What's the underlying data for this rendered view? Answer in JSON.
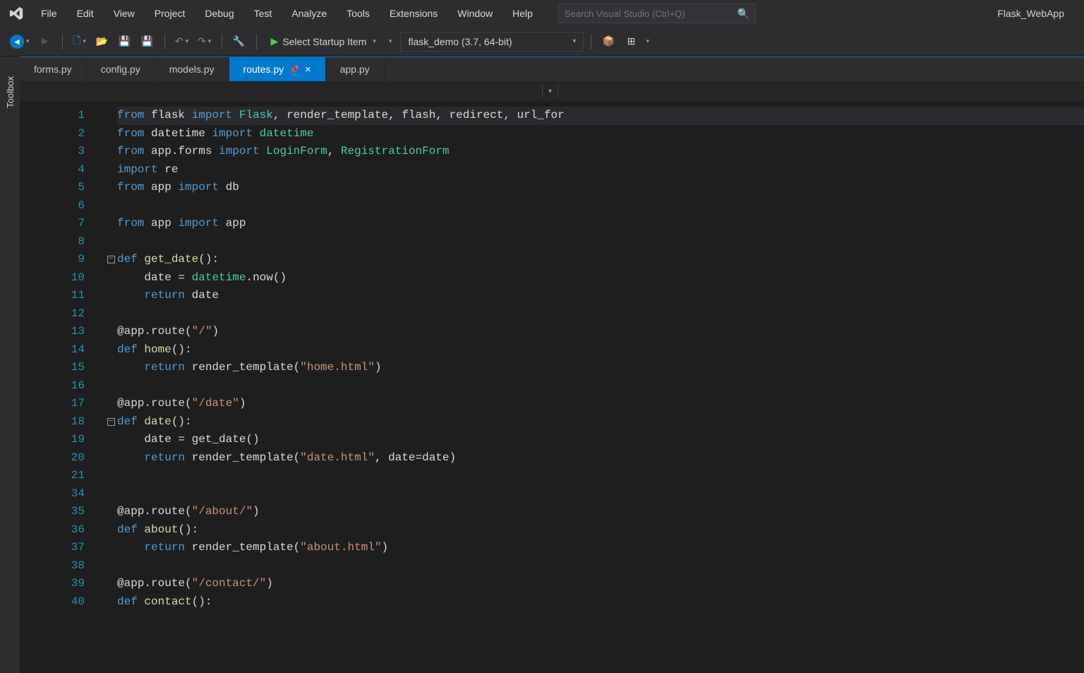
{
  "menu": {
    "items": [
      "File",
      "Edit",
      "View",
      "Project",
      "Debug",
      "Test",
      "Analyze",
      "Tools",
      "Extensions",
      "Window",
      "Help"
    ]
  },
  "search": {
    "placeholder": "Search Visual Studio (Ctrl+Q)"
  },
  "project_label": "Flask_WebApp",
  "toolbar": {
    "startup": "Select Startup Item",
    "env": "flask_demo (3.7, 64-bit)"
  },
  "side_tab": "Toolbox",
  "tabs": [
    {
      "label": "forms.py",
      "active": false
    },
    {
      "label": "config.py",
      "active": false
    },
    {
      "label": "models.py",
      "active": false
    },
    {
      "label": "routes.py",
      "active": true,
      "pinned": true,
      "closable": true
    },
    {
      "label": "app.py",
      "active": false
    }
  ],
  "code": {
    "line_numbers": [
      1,
      2,
      3,
      4,
      5,
      6,
      7,
      8,
      9,
      10,
      11,
      12,
      13,
      14,
      15,
      16,
      17,
      18,
      19,
      20,
      21,
      34,
      35,
      36,
      37,
      38,
      39,
      40
    ],
    "lines": [
      {
        "t": [
          [
            "kw",
            "from"
          ],
          [
            "id",
            " "
          ],
          [
            "mod",
            "flask"
          ],
          [
            "id",
            " "
          ],
          [
            "kw",
            "import"
          ],
          [
            "id",
            " "
          ],
          [
            "cls",
            "Flask"
          ],
          [
            "punc",
            ", "
          ],
          [
            "id",
            "render_template"
          ],
          [
            "punc",
            ", "
          ],
          [
            "id",
            "flash"
          ],
          [
            "punc",
            ", "
          ],
          [
            "id",
            "redirect"
          ],
          [
            "punc",
            ", "
          ],
          [
            "id",
            "url_for"
          ]
        ]
      },
      {
        "t": [
          [
            "kw",
            "from"
          ],
          [
            "id",
            " "
          ],
          [
            "mod",
            "datetime"
          ],
          [
            "id",
            " "
          ],
          [
            "kw",
            "import"
          ],
          [
            "id",
            " "
          ],
          [
            "cls",
            "datetime"
          ]
        ]
      },
      {
        "t": [
          [
            "kw",
            "from"
          ],
          [
            "id",
            " "
          ],
          [
            "mod",
            "app.forms"
          ],
          [
            "id",
            " "
          ],
          [
            "kw",
            "import"
          ],
          [
            "id",
            " "
          ],
          [
            "cls",
            "LoginForm"
          ],
          [
            "punc",
            ", "
          ],
          [
            "cls",
            "RegistrationForm"
          ]
        ]
      },
      {
        "t": [
          [
            "kw",
            "import"
          ],
          [
            "id",
            " "
          ],
          [
            "mod",
            "re"
          ]
        ]
      },
      {
        "t": [
          [
            "kw",
            "from"
          ],
          [
            "id",
            " "
          ],
          [
            "mod",
            "app"
          ],
          [
            "id",
            " "
          ],
          [
            "kw",
            "import"
          ],
          [
            "id",
            " "
          ],
          [
            "id",
            "db"
          ]
        ]
      },
      {
        "t": [
          [
            "",
            ""
          ]
        ]
      },
      {
        "t": [
          [
            "kw",
            "from"
          ],
          [
            "id",
            " "
          ],
          [
            "mod",
            "app"
          ],
          [
            "id",
            " "
          ],
          [
            "kw",
            "import"
          ],
          [
            "id",
            " "
          ],
          [
            "id",
            "app"
          ]
        ]
      },
      {
        "t": [
          [
            "",
            ""
          ]
        ]
      },
      {
        "fold": true,
        "t": [
          [
            "kw",
            "def"
          ],
          [
            "id",
            " "
          ],
          [
            "fn",
            "get_date"
          ],
          [
            "punc",
            "():"
          ]
        ]
      },
      {
        "indent": 1,
        "t": [
          [
            "id",
            "date "
          ],
          [
            "op",
            "="
          ],
          [
            "id",
            " "
          ],
          [
            "cls",
            "datetime"
          ],
          [
            "punc",
            "."
          ],
          [
            "id",
            "now"
          ],
          [
            "punc",
            "()"
          ]
        ]
      },
      {
        "indent": 1,
        "t": [
          [
            "kw",
            "return"
          ],
          [
            "id",
            " date"
          ]
        ]
      },
      {
        "t": [
          [
            "",
            ""
          ]
        ]
      },
      {
        "t": [
          [
            "dec",
            "@app.route"
          ],
          [
            "punc",
            "("
          ],
          [
            "str",
            "\"/\""
          ],
          [
            "punc",
            ")"
          ]
        ]
      },
      {
        "t": [
          [
            "kw",
            "def"
          ],
          [
            "id",
            " "
          ],
          [
            "fn",
            "home"
          ],
          [
            "punc",
            "():"
          ]
        ]
      },
      {
        "indent": 1,
        "t": [
          [
            "kw",
            "return"
          ],
          [
            "id",
            " render_template"
          ],
          [
            "punc",
            "("
          ],
          [
            "str",
            "\"home.html\""
          ],
          [
            "punc",
            ")"
          ]
        ]
      },
      {
        "t": [
          [
            "",
            ""
          ]
        ]
      },
      {
        "t": [
          [
            "dec",
            "@app.route"
          ],
          [
            "punc",
            "("
          ],
          [
            "str",
            "\"/date\""
          ],
          [
            "punc",
            ")"
          ]
        ]
      },
      {
        "fold": true,
        "t": [
          [
            "kw",
            "def"
          ],
          [
            "id",
            " "
          ],
          [
            "fn",
            "date"
          ],
          [
            "punc",
            "():"
          ]
        ]
      },
      {
        "indent": 1,
        "t": [
          [
            "id",
            "date "
          ],
          [
            "op",
            "="
          ],
          [
            "id",
            " get_date"
          ],
          [
            "punc",
            "()"
          ]
        ]
      },
      {
        "indent": 1,
        "t": [
          [
            "kw",
            "return"
          ],
          [
            "id",
            " render_template"
          ],
          [
            "punc",
            "("
          ],
          [
            "str",
            "\"date.html\""
          ],
          [
            "punc",
            ", "
          ],
          [
            "id",
            "date"
          ],
          [
            "op",
            "="
          ],
          [
            "id",
            "date"
          ],
          [
            "punc",
            ")"
          ]
        ]
      },
      {
        "t": [
          [
            "",
            ""
          ]
        ]
      },
      {
        "t": [
          [
            "",
            ""
          ]
        ]
      },
      {
        "t": [
          [
            "dec",
            "@app.route"
          ],
          [
            "punc",
            "("
          ],
          [
            "str",
            "\"/about/\""
          ],
          [
            "punc",
            ")"
          ]
        ]
      },
      {
        "t": [
          [
            "kw",
            "def"
          ],
          [
            "id",
            " "
          ],
          [
            "fn",
            "about"
          ],
          [
            "punc",
            "():"
          ]
        ]
      },
      {
        "indent": 1,
        "t": [
          [
            "kw",
            "return"
          ],
          [
            "id",
            " render_template"
          ],
          [
            "punc",
            "("
          ],
          [
            "str",
            "\"about.html\""
          ],
          [
            "punc",
            ")"
          ]
        ]
      },
      {
        "t": [
          [
            "",
            ""
          ]
        ]
      },
      {
        "t": [
          [
            "dec",
            "@app.route"
          ],
          [
            "punc",
            "("
          ],
          [
            "str",
            "\"/contact/\""
          ],
          [
            "punc",
            ")"
          ]
        ]
      },
      {
        "t": [
          [
            "kw",
            "def"
          ],
          [
            "id",
            " "
          ],
          [
            "fn",
            "contact"
          ],
          [
            "punc",
            "():"
          ]
        ]
      }
    ]
  }
}
